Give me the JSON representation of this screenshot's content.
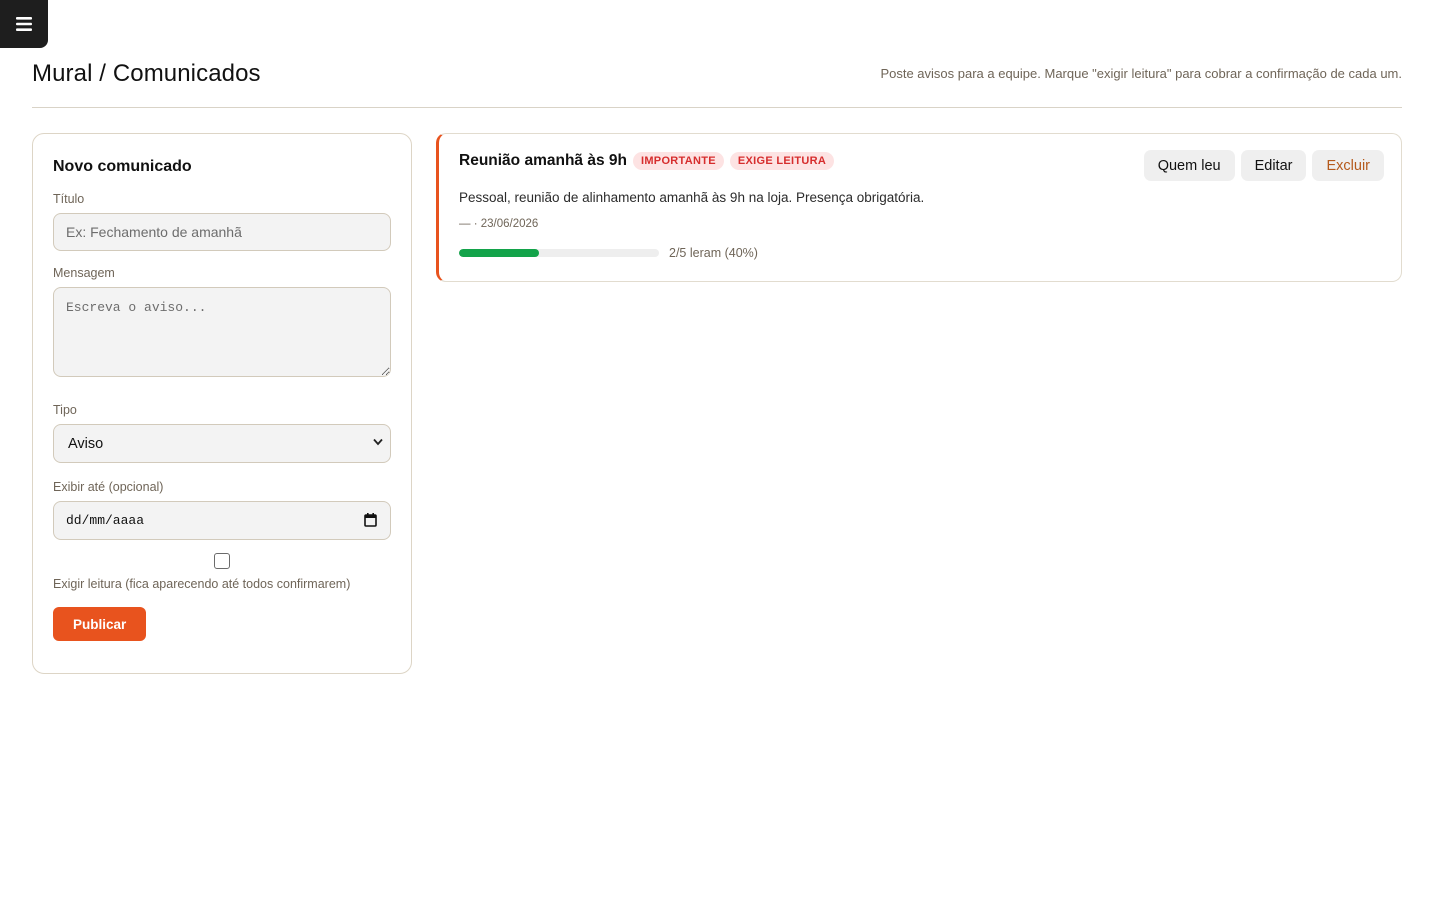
{
  "header": {
    "title": "Mural / Comunicados",
    "hint": "Poste avisos para a equipe. Marque \"exigir leitura\" para cobrar a confirmação de cada um."
  },
  "menu": {
    "icon": "hamburger-menu-icon"
  },
  "form": {
    "title": "Novo comunicado",
    "title_label": "Título",
    "title_placeholder": "Ex: Fechamento de amanhã",
    "message_label": "Mensagem",
    "message_placeholder": "Escreva o aviso...",
    "type_label": "Tipo",
    "type_value": "Aviso",
    "display_until_label": "Exibir até (opcional)",
    "date_placeholder": "dd/mm/aaaa",
    "require_read_label": "Exigir leitura (fica aparecendo até todos confirmarem)",
    "require_read_checked": false,
    "publish_label": "Publicar"
  },
  "notices": [
    {
      "title": "Reunião amanhã às 9h",
      "badges": [
        "IMPORTANTE",
        "EXIGE LEITURA"
      ],
      "body": "Pessoal, reunião de alinhamento amanhã às 9h na loja. Presença obrigatória.",
      "meta": "— · 23/06/2026",
      "read_fraction": 0.4,
      "read_text": "2/5 leram (40%)",
      "actions": {
        "who_read": "Quem leu",
        "edit": "Editar",
        "delete": "Excluir"
      }
    }
  ],
  "colors": {
    "accent": "#e8531e",
    "progress": "#13a34a",
    "badge_bg": "#fde3e3",
    "badge_text": "#d62d2d"
  }
}
